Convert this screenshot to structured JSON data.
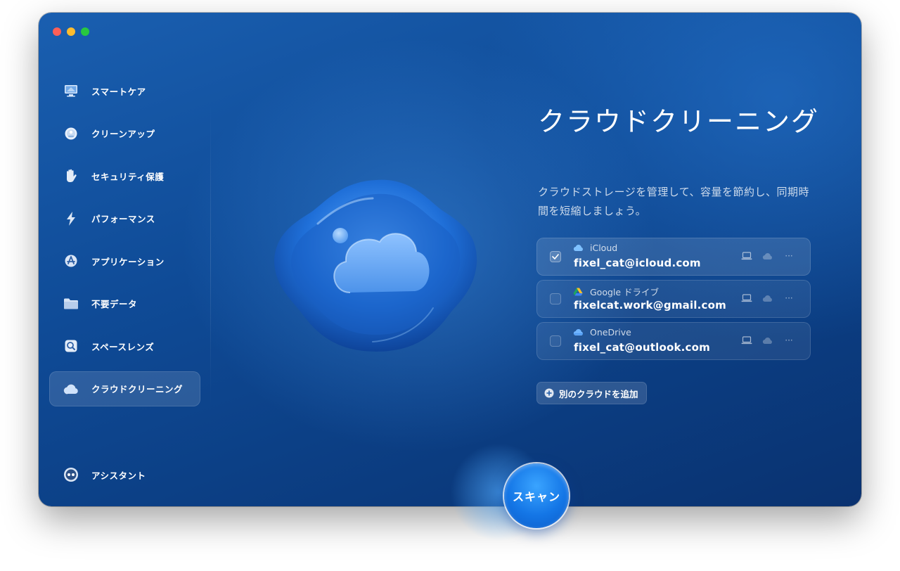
{
  "sidebar": {
    "items": [
      {
        "label": "スマートケア",
        "icon": "monitor-icon",
        "active": false
      },
      {
        "label": "クリーンアップ",
        "icon": "disk-icon",
        "active": false
      },
      {
        "label": "セキュリティ保護",
        "icon": "hand-icon",
        "active": false
      },
      {
        "label": "パフォーマンス",
        "icon": "lightning-icon",
        "active": false
      },
      {
        "label": "アプリケーション",
        "icon": "app-icon",
        "active": false
      },
      {
        "label": "不要データ",
        "icon": "folder-icon",
        "active": false
      },
      {
        "label": "スペースレンズ",
        "icon": "lens-icon",
        "active": false
      },
      {
        "label": "クラウドクリーニング",
        "icon": "cloud-icon",
        "active": true
      }
    ],
    "assistant": {
      "label": "アシスタント",
      "icon": "assistant-icon"
    }
  },
  "main": {
    "title": "クラウドクリーニング",
    "subtitle": "クラウドストレージを管理して、容量を節約し、同期時間を短縮しましょう。",
    "accounts": [
      {
        "provider": "iCloud",
        "email": "fixel_cat@icloud.com",
        "checked": true,
        "provider_icon": "icloud-icon"
      },
      {
        "provider": "Google ドライブ",
        "email": "fixelcat.work@gmail.com",
        "checked": false,
        "provider_icon": "google-drive-icon"
      },
      {
        "provider": "OneDrive",
        "email": "fixel_cat@outlook.com",
        "checked": false,
        "provider_icon": "onedrive-icon"
      }
    ],
    "row_more": "···",
    "add_cloud_label": "別のクラウドを追加",
    "scan_label": "スキャン"
  },
  "colors": {
    "background_top": "#1a5fb0",
    "background_bottom": "#0a3270",
    "scan_button": "#1476e6",
    "traffic_red": "#fe5f57",
    "traffic_yellow": "#febc2e",
    "traffic_green": "#28c840"
  }
}
